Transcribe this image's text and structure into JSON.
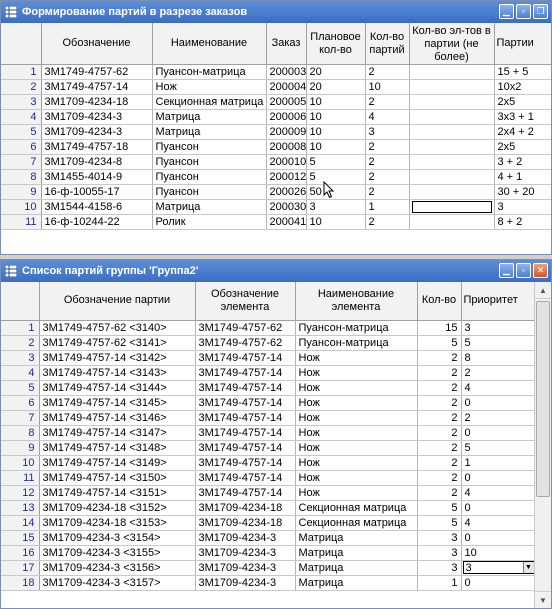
{
  "win1": {
    "title": "Формирование партий в разрезе заказов",
    "columns": [
      "",
      "Обозначение",
      "Наименование",
      "Заказ",
      "Плановое кол-во",
      "Кол-во партий",
      "Кол-во эл-тов в партии (не более)",
      "Партии"
    ],
    "rows": [
      {
        "n": "1",
        "code": "3M1749-4757-62",
        "name": "Пуансон-матрица",
        "order": "200003",
        "plan": "20",
        "parts": "2",
        "max": "",
        "lots": "15 + 5"
      },
      {
        "n": "2",
        "code": "3M1749-4757-14",
        "name": "Нож",
        "order": "200004",
        "plan": "20",
        "parts": "10",
        "max": "",
        "lots": "10x2"
      },
      {
        "n": "3",
        "code": "3M1709-4234-18",
        "name": "Секционная матрица",
        "order": "200005",
        "plan": "10",
        "parts": "2",
        "max": "",
        "lots": "2x5"
      },
      {
        "n": "4",
        "code": "3M1709-4234-3",
        "name": "Матрица",
        "order": "200006",
        "plan": "10",
        "parts": "4",
        "max": "",
        "lots": "3x3 + 1"
      },
      {
        "n": "5",
        "code": "3M1709-4234-3",
        "name": "Матрица",
        "order": "200009",
        "plan": "10",
        "parts": "3",
        "max": "",
        "lots": "2x4 + 2"
      },
      {
        "n": "6",
        "code": "3M1749-4757-18",
        "name": "Пуансон",
        "order": "200008",
        "plan": "10",
        "parts": "2",
        "max": "",
        "lots": "2x5"
      },
      {
        "n": "7",
        "code": "3M1709-4234-8",
        "name": "Пуансон",
        "order": "200010",
        "plan": "5",
        "parts": "2",
        "max": "",
        "lots": "3 + 2"
      },
      {
        "n": "8",
        "code": "3M1455-4014-9",
        "name": "Пуансон",
        "order": "200012",
        "plan": "5",
        "parts": "2",
        "max": "",
        "lots": "4 + 1"
      },
      {
        "n": "9",
        "code": "16-ф-10055-17",
        "name": "Пуансон",
        "order": "200026",
        "plan": "50",
        "parts": "2",
        "max": "",
        "lots": "30 + 20"
      },
      {
        "n": "10",
        "code": "3M1544-4158-6",
        "name": "Матрица",
        "order": "200030",
        "plan": "3",
        "parts": "1",
        "max": "",
        "lots": "3"
      },
      {
        "n": "11",
        "code": "16-ф-10244-22",
        "name": "Ролик",
        "order": "200041",
        "plan": "10",
        "parts": "2",
        "max": "",
        "lots": "8 + 2"
      }
    ]
  },
  "win2": {
    "title": "Список партий группы 'Группа2'",
    "columns": [
      "",
      "Обозначение партии",
      "Обозначение элемента",
      "Наименование элемента",
      "Кол-во",
      "Приоритет"
    ],
    "rows": [
      {
        "n": "1",
        "lot": "3M1749-4757-62 <3140>",
        "elem": "3M1749-4757-62",
        "name": "Пуансон-матрица",
        "qty": "15",
        "prio": "3"
      },
      {
        "n": "2",
        "lot": "3M1749-4757-62 <3141>",
        "elem": "3M1749-4757-62",
        "name": "Пуансон-матрица",
        "qty": "5",
        "prio": "5"
      },
      {
        "n": "3",
        "lot": "3M1749-4757-14 <3142>",
        "elem": "3M1749-4757-14",
        "name": "Нож",
        "qty": "2",
        "prio": "8"
      },
      {
        "n": "4",
        "lot": "3M1749-4757-14 <3143>",
        "elem": "3M1749-4757-14",
        "name": "Нож",
        "qty": "2",
        "prio": "2"
      },
      {
        "n": "5",
        "lot": "3M1749-4757-14 <3144>",
        "elem": "3M1749-4757-14",
        "name": "Нож",
        "qty": "2",
        "prio": "4"
      },
      {
        "n": "6",
        "lot": "3M1749-4757-14 <3145>",
        "elem": "3M1749-4757-14",
        "name": "Нож",
        "qty": "2",
        "prio": "0"
      },
      {
        "n": "7",
        "lot": "3M1749-4757-14 <3146>",
        "elem": "3M1749-4757-14",
        "name": "Нож",
        "qty": "2",
        "prio": "2"
      },
      {
        "n": "8",
        "lot": "3M1749-4757-14 <3147>",
        "elem": "3M1749-4757-14",
        "name": "Нож",
        "qty": "2",
        "prio": "0"
      },
      {
        "n": "9",
        "lot": "3M1749-4757-14 <3148>",
        "elem": "3M1749-4757-14",
        "name": "Нож",
        "qty": "2",
        "prio": "5"
      },
      {
        "n": "10",
        "lot": "3M1749-4757-14 <3149>",
        "elem": "3M1749-4757-14",
        "name": "Нож",
        "qty": "2",
        "prio": "1"
      },
      {
        "n": "11",
        "lot": "3M1749-4757-14 <3150>",
        "elem": "3M1749-4757-14",
        "name": "Нож",
        "qty": "2",
        "prio": "0"
      },
      {
        "n": "12",
        "lot": "3M1749-4757-14 <3151>",
        "elem": "3M1749-4757-14",
        "name": "Нож",
        "qty": "2",
        "prio": "4"
      },
      {
        "n": "13",
        "lot": "3M1709-4234-18 <3152>",
        "elem": "3M1709-4234-18",
        "name": "Секционная матрица",
        "qty": "5",
        "prio": "0"
      },
      {
        "n": "14",
        "lot": "3M1709-4234-18 <3153>",
        "elem": "3M1709-4234-18",
        "name": "Секционная матрица",
        "qty": "5",
        "prio": "4"
      },
      {
        "n": "15",
        "lot": "3M1709-4234-3 <3154>",
        "elem": "3M1709-4234-3",
        "name": "Матрица",
        "qty": "3",
        "prio": "0"
      },
      {
        "n": "16",
        "lot": "3M1709-4234-3 <3155>",
        "elem": "3M1709-4234-3",
        "name": "Матрица",
        "qty": "3",
        "prio": "10"
      },
      {
        "n": "17",
        "lot": "3M1709-4234-3 <3156>",
        "elem": "3M1709-4234-3",
        "name": "Матрица",
        "qty": "3",
        "prio": "3"
      },
      {
        "n": "18",
        "lot": "3M1709-4234-3 <3157>",
        "elem": "3M1709-4234-3",
        "name": "Матрица",
        "qty": "1",
        "prio": "0"
      }
    ]
  }
}
